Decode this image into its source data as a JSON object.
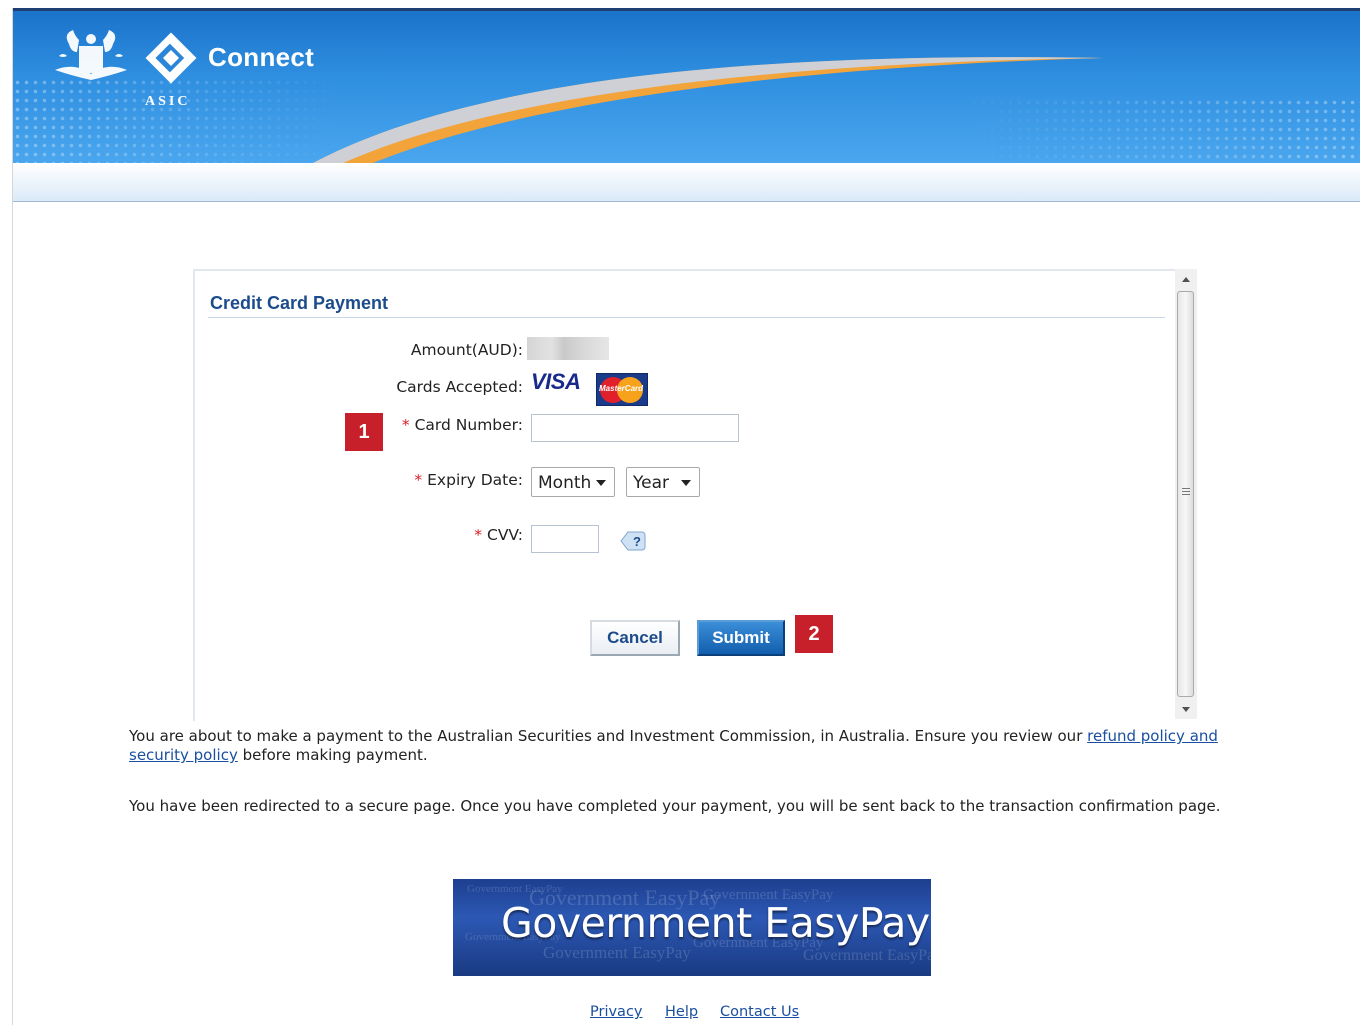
{
  "header": {
    "brand_name": "Connect",
    "brand_sub": "ASIC"
  },
  "form": {
    "title": "Credit Card Payment",
    "amount_label": "Amount(AUD):",
    "cards_label": "Cards Accepted:",
    "card_brands": [
      "VISA",
      "MasterCard"
    ],
    "card_number_label": "Card Number:",
    "expiry_label": "Expiry Date:",
    "month_value": "Month",
    "year_value": "Year",
    "cvv_label": "CVV:",
    "required_marker": "*",
    "help_icon": "question-icon",
    "cancel_label": "Cancel",
    "submit_label": "Submit"
  },
  "callouts": [
    "1",
    "2"
  ],
  "info": {
    "line1_text": "You are about to make a payment to the Australian Securities and Investment Commission, in Australia. Ensure you review our ",
    "link_text": "refund policy and security policy",
    "line1_end": " before making payment.",
    "line2": "You have been redirected to a secure page. Once you have completed your payment, you will be sent back to the transaction confirmation page."
  },
  "banner": {
    "text": "Government EasyPay"
  },
  "footer": {
    "links": [
      "Privacy",
      "Help",
      "Contact Us"
    ]
  },
  "colors": {
    "header_blue": "#2f8fe0",
    "title_blue": "#1c4c8c",
    "required_red": "#d8212a",
    "callout_red": "#c8202a",
    "submit_blue": "#125eae",
    "link_blue": "#1a4fa0"
  }
}
